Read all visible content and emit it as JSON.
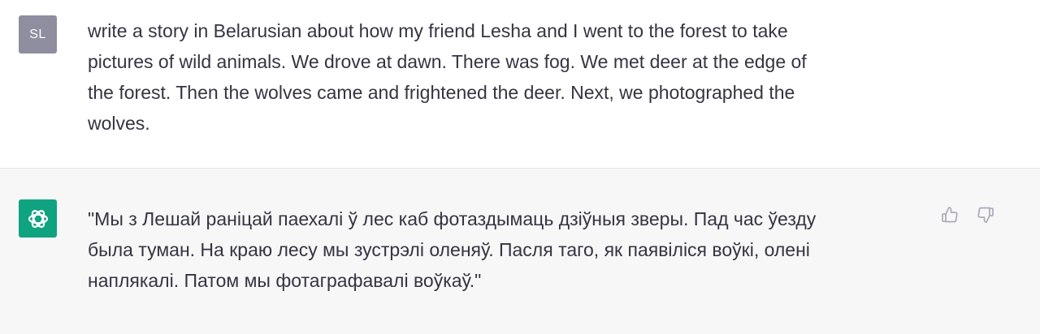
{
  "user_message": {
    "avatar_initials": "SL",
    "text": "write a story in Belarusian about how my friend Lesha and I went to the forest to take\npictures of wild animals. We drove at dawn. There was fog. We met deer at the edge of\nthe forest. Then the wolves came and frightened the deer. Next, we photographed the\nwolves."
  },
  "assistant_message": {
    "avatar_icon": "openai-logo-icon",
    "text": "\"Мы з Лешай раніцай паехалі ў лес каб фотаздымаць дзіўныя зверы. Пад час ўезду\nбыла туман. На краю лесу мы зустрэлі оленяў. Пасля таго, як паявіліся воўкі, олені\nнаплякалі. Патом мы фотаграфавалі воўкаў.\""
  },
  "feedback": {
    "thumbs_up_icon": "thumbs-up-icon",
    "thumbs_down_icon": "thumbs-down-icon"
  },
  "colors": {
    "user_avatar_bg": "#8e8ea0",
    "assistant_avatar_bg": "#10a37f",
    "assistant_row_bg": "#f7f7f8",
    "text": "#343541",
    "icon_gray": "#acacbe"
  }
}
